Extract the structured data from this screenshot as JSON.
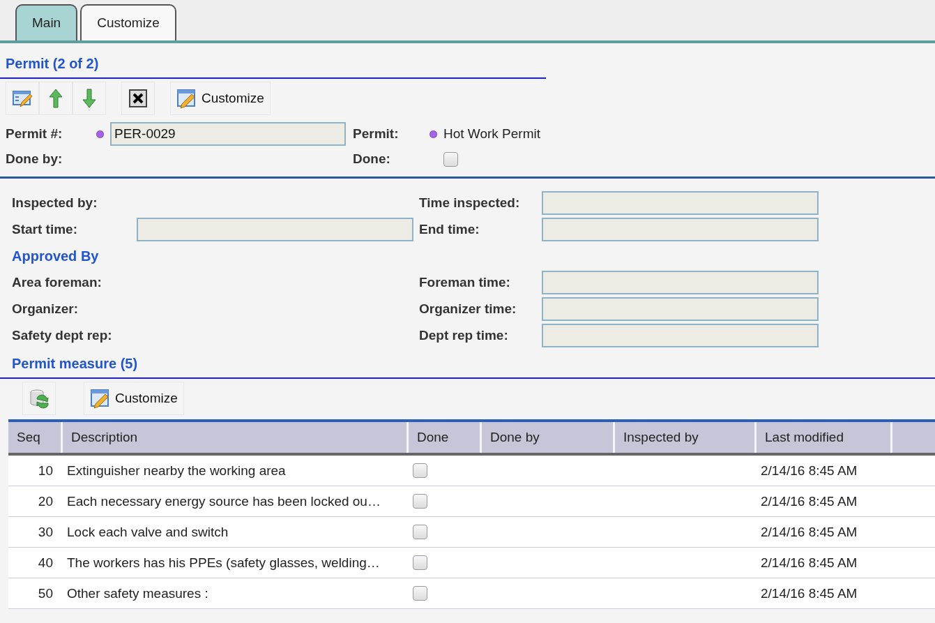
{
  "tabs": [
    {
      "label": "Main",
      "selected": true
    },
    {
      "label": "Customize",
      "selected": false
    }
  ],
  "permit": {
    "title": "Permit (2 of 2)",
    "toolbar": [
      {
        "kind": "edit"
      },
      {
        "kind": "up"
      },
      {
        "kind": "down"
      },
      {
        "kind": "delete"
      },
      {
        "kind": "customize",
        "label": "Customize"
      }
    ],
    "fields": [
      {
        "label": "Permit #:",
        "required": true,
        "kind": "input",
        "value": "PER-0029"
      },
      {
        "label": "Permit:",
        "required": true,
        "kind": "text",
        "value": "Hot Work Permit"
      },
      {
        "label": "Done by:",
        "required": false,
        "kind": "empty"
      },
      {
        "label": "Done:",
        "required": false,
        "kind": "checkbox",
        "checked": false
      }
    ]
  },
  "details": [
    {
      "kind": "pair",
      "left": {
        "label": "Inspected by:",
        "kind": "empty"
      },
      "right": {
        "label": "Time inspected:",
        "kind": "input"
      }
    },
    {
      "kind": "pair",
      "left": {
        "label": "Start time:",
        "kind": "input"
      },
      "right": {
        "label": "End time:",
        "kind": "input"
      }
    },
    {
      "kind": "heading",
      "label": "Approved By"
    },
    {
      "kind": "pair",
      "left": {
        "label": "Area foreman:",
        "kind": "empty"
      },
      "right": {
        "label": "Foreman time:",
        "kind": "input"
      }
    },
    {
      "kind": "pair",
      "left": {
        "label": "Organizer:",
        "kind": "empty"
      },
      "right": {
        "label": "Organizer time:",
        "kind": "input"
      }
    },
    {
      "kind": "pair",
      "left": {
        "label": "Safety dept rep:",
        "kind": "empty"
      },
      "right": {
        "label": "Dept rep time:",
        "kind": "input"
      }
    }
  ],
  "measures": {
    "title": "Permit measure (5)",
    "toolbar": [
      {
        "kind": "refresh"
      },
      {
        "kind": "customize",
        "label": "Customize"
      }
    ],
    "columns": [
      "Seq",
      "Description",
      "Done",
      "Done by",
      "Inspected by",
      "Last modified"
    ],
    "rows": [
      {
        "seq": "10",
        "description": "Extinguisher nearby the working area",
        "done": false,
        "last_modified": "2/14/16 8:45 AM"
      },
      {
        "seq": "20",
        "description": "Each necessary energy source has been locked ou…",
        "done": false,
        "last_modified": "2/14/16 8:45 AM"
      },
      {
        "seq": "30",
        "description": "Lock each valve and switch",
        "done": false,
        "last_modified": "2/14/16 8:45 AM"
      },
      {
        "seq": "40",
        "description": "The workers has his PPEs (safety glasses, welding…",
        "done": false,
        "last_modified": "2/14/16 8:45 AM"
      },
      {
        "seq": "50",
        "description": "Other safety measures :",
        "done": false,
        "last_modified": "2/14/16 8:45 AM"
      }
    ]
  }
}
